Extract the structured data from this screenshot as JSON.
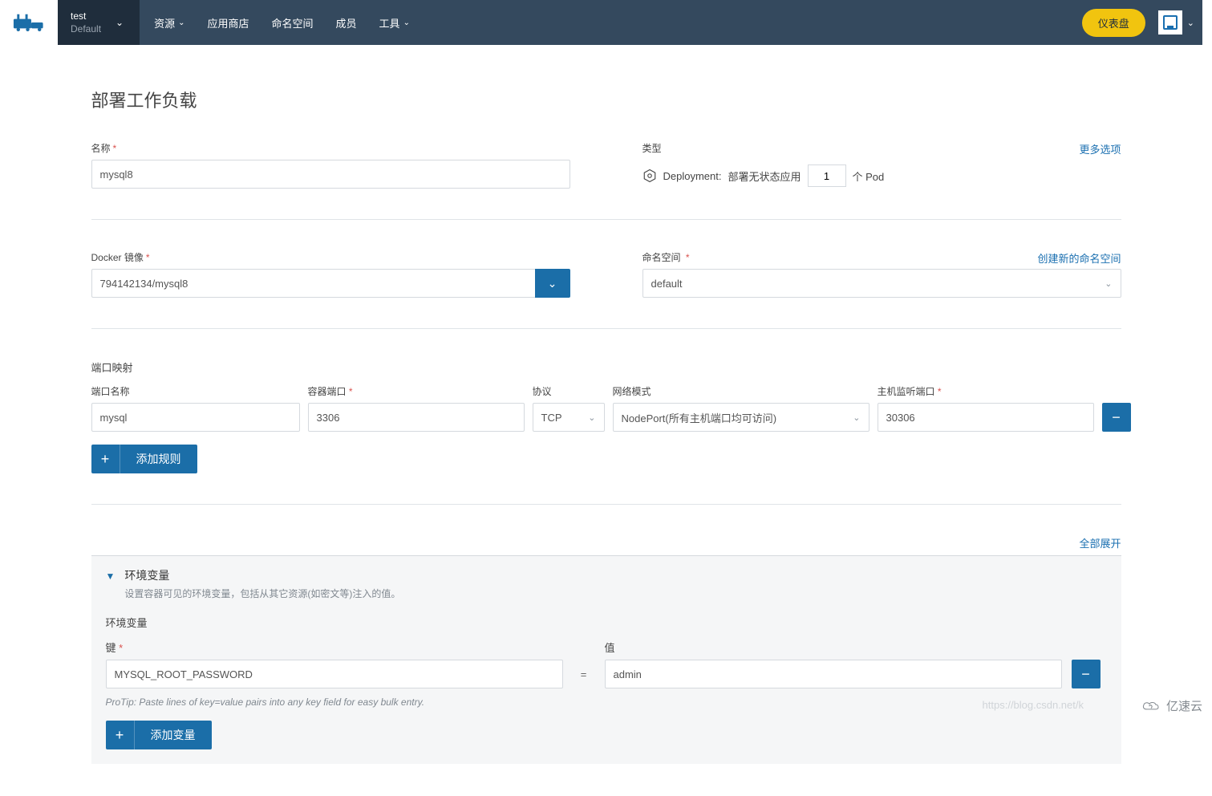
{
  "nav": {
    "project_name": "test",
    "project_ctx": "Default",
    "items": [
      "资源",
      "应用商店",
      "命名空间",
      "成员",
      "工具"
    ],
    "dashboard_btn": "仪表盘"
  },
  "page": {
    "title": "部署工作负载"
  },
  "name_section": {
    "label": "名称",
    "value": "mysql8"
  },
  "type_section": {
    "label": "类型",
    "more_link": "更多选项",
    "prefix": "Deployment:",
    "desc": "部署无状态应用",
    "count": "1",
    "suffix": "个 Pod"
  },
  "image_section": {
    "label": "Docker 镜像",
    "value": "794142134/mysql8"
  },
  "ns_section": {
    "label": "命名空间",
    "create_link": "创建新的命名空间",
    "value": "default"
  },
  "ports": {
    "title": "端口映射",
    "cols": {
      "name": "端口名称",
      "container": "容器端口",
      "protocol": "协议",
      "mode": "网络模式",
      "host": "主机监听端口"
    },
    "row": {
      "name": "mysql",
      "container": "3306",
      "protocol": "TCP",
      "mode": "NodePort(所有主机端口均可访问)",
      "host": "30306"
    },
    "add_btn": "添加规则"
  },
  "expand_all": "全部展开",
  "env_panel": {
    "title": "环境变量",
    "sub": "设置容器可见的环境变量，包括从其它资源(如密文等)注入的值。",
    "section_label": "环境变量",
    "key_label": "键",
    "val_label": "值",
    "key": "MYSQL_ROOT_PASSWORD",
    "val": "admin",
    "protip": "ProTip: Paste lines of key=value pairs into any key field for easy bulk entry.",
    "add_btn": "添加变量"
  },
  "watermarks": {
    "csdn": "https://blog.csdn.net/k",
    "yisu": "亿速云"
  }
}
